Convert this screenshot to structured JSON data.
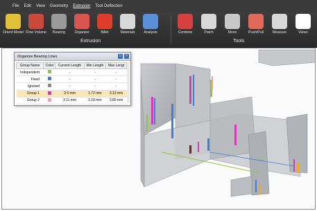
{
  "menu": [
    "File",
    "Edit",
    "View",
    "Geometry",
    "Extrusion",
    "Tool Deflection"
  ],
  "menu_active": "Extrusion",
  "ribbon": {
    "extrusion_tools": [
      {
        "label": "Orient Model",
        "icon": "orient-model-icon",
        "color": "#e2c13a"
      },
      {
        "label": "Flow Volume",
        "icon": "flow-volume-icon",
        "color": "#c84a3a"
      },
      {
        "label": "Bearing",
        "icon": "bearing-icon",
        "color": "#9a9a9a"
      },
      {
        "label": "Organize",
        "icon": "organize-icon",
        "color": "#d9534f"
      },
      {
        "label": "Billet",
        "icon": "billet-icon",
        "color": "#e03c2c"
      },
      {
        "label": "Materials",
        "icon": "materials-icon",
        "color": "#d8d8d8"
      },
      {
        "label": "Analysis",
        "icon": "analysis-icon",
        "color": "#5a8fd8"
      }
    ],
    "extrusion_group": "Extrusion",
    "tools_tools": [
      {
        "label": "Combine",
        "icon": "combine-icon",
        "color": "#d84040"
      },
      {
        "label": "Patch",
        "icon": "patch-icon",
        "color": "#d8d8d8"
      },
      {
        "label": "Move",
        "icon": "move-icon",
        "color": "#c8c8c8"
      },
      {
        "label": "Push/Pull",
        "icon": "push-pull-icon",
        "color": "#e06a5a"
      },
      {
        "label": "Measure",
        "icon": "measure-icon",
        "color": "#d8d8d8"
      },
      {
        "label": "Views",
        "icon": "views-icon",
        "color": "#ffffff"
      }
    ],
    "tools_group": "Tools"
  },
  "panel": {
    "title": "Organize Bearing Lines",
    "columns": [
      "Group Name",
      "Color",
      "Current Length",
      "Min Length",
      "Max Lengt"
    ],
    "rows": [
      {
        "name": "Independent",
        "color": "#8cc63e",
        "current": "-",
        "min": "-",
        "max": "-",
        "highlight": false
      },
      {
        "name": "Fixed",
        "color": "#3d7fd9",
        "current": "-",
        "min": "-",
        "max": "-",
        "highlight": false
      },
      {
        "name": "Ignored",
        "color": "#8a8a8a",
        "current": "-",
        "min": "-",
        "max": "-",
        "highlight": false
      },
      {
        "name": "Group 1",
        "color": "#d63bb5",
        "current": "2.5 mm",
        "min": "1.72 mm",
        "max": "3.13 mm",
        "highlight": true
      },
      {
        "name": "Group 2",
        "color": "#f0a0a8",
        "current": "3.11 mm",
        "min": "2.18 mm",
        "max": "3.80 mm",
        "highlight": false
      }
    ]
  },
  "colors": {
    "ribbon_bg": "#2f2f2f",
    "highlight_row": "#fbe6b8",
    "model_grey": "#a7a9ad"
  }
}
